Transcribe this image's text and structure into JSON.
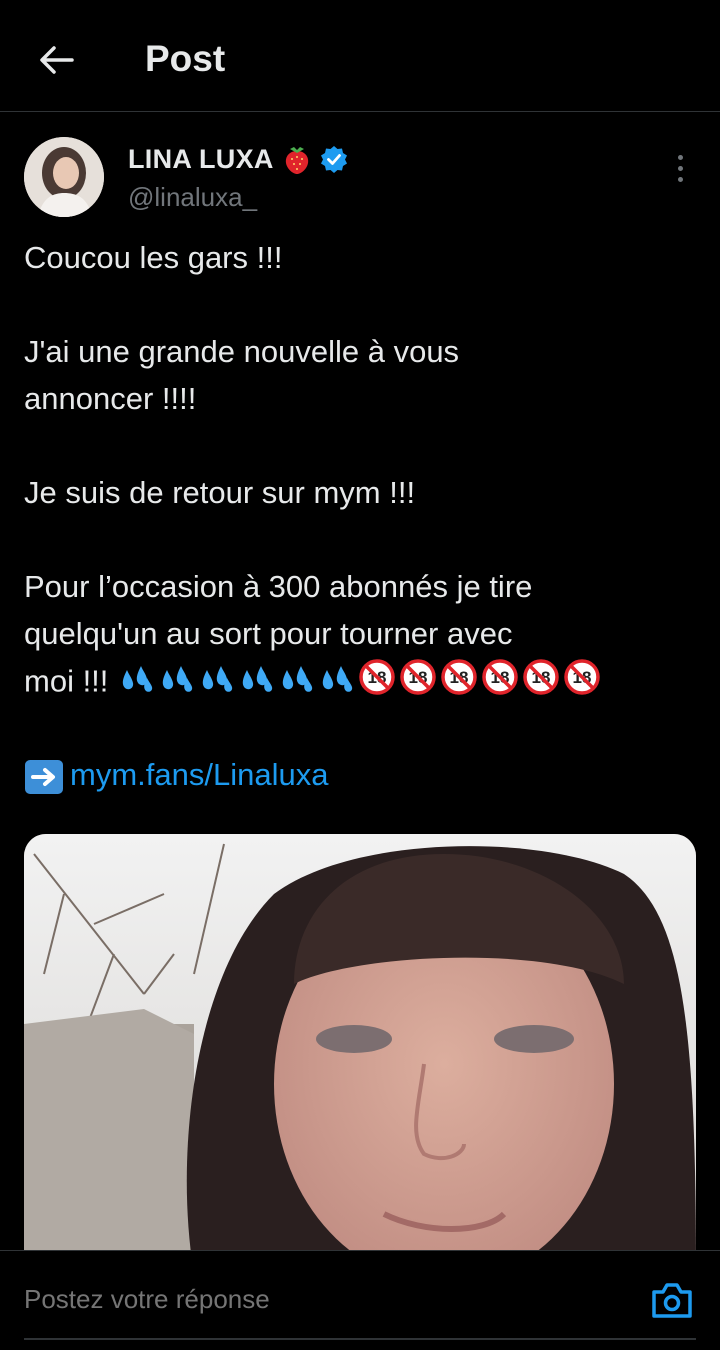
{
  "header": {
    "title": "Post"
  },
  "author": {
    "display_name": "LINA LUXA",
    "handle": "@linaluxa_",
    "badge_emoji": "strawberry-icon",
    "verified": true
  },
  "tweet": {
    "line1": "Coucou les gars !!!",
    "line2": "J'ai une grande nouvelle à vous",
    "line3": "annoncer !!!!",
    "line4": "Je suis de retour sur mym !!!",
    "line5": "Pour l’occasion à 300 abonnés je tire",
    "line6": "quelqu'un au sort pour tourner avec",
    "line7": "moi !!!",
    "link_text": "mym.fans/Linaluxa",
    "emoji_droplets_count": 6,
    "emoji_18_count": 6
  },
  "reply": {
    "placeholder": "Postez votre réponse"
  },
  "colors": {
    "background": "#000000",
    "text": "#e7e9ea",
    "secondary": "#71767b",
    "accent": "#1d9bf0",
    "divider": "#2f3336"
  }
}
